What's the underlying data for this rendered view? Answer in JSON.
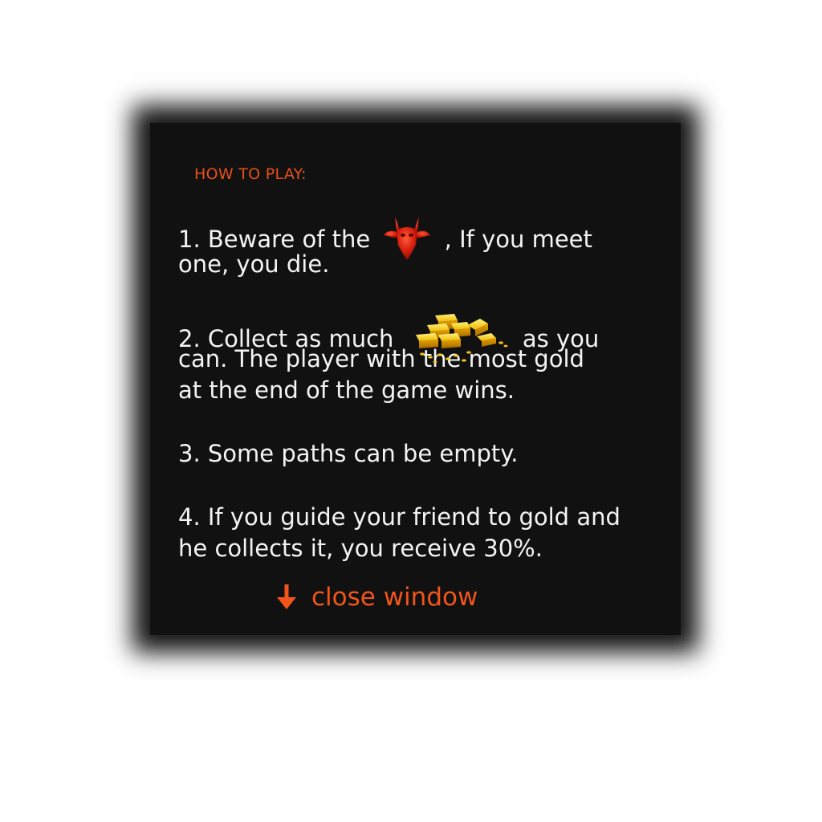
{
  "dialog": {
    "heading": "HOW TO PLAY:",
    "rules": [
      {
        "line1_before": "1. Beware of the",
        "line1_after": ", If you meet",
        "line2": "one, you die.",
        "icon": "demon-head-icon"
      },
      {
        "line1_before": "2. Collect as much",
        "line1_after": "as you",
        "line2": "can. The player with the most gold",
        "line3": "at the end of the game wins.",
        "icon": "gold-bars-icon"
      },
      {
        "line1": "3. Some paths can be empty."
      },
      {
        "line1": "4. If you guide your friend to gold and",
        "line2": "he collects it, you receive 30%."
      }
    ],
    "close_label": "close window",
    "close_icon": "arrow-down-icon"
  },
  "colors": {
    "accent": "#f2551a",
    "panel": "#111111",
    "text": "#f4f4f4",
    "demon": "#c81a0a",
    "gold": "#f0c020"
  }
}
